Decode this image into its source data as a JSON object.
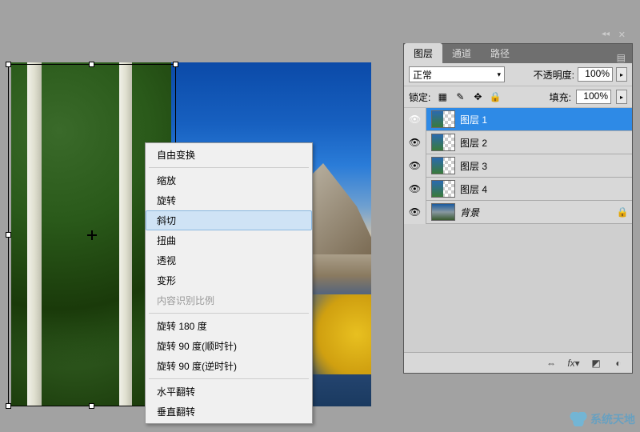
{
  "canvas": {
    "alt": "mountain-lake-landscape"
  },
  "context_menu": {
    "items": [
      {
        "label": "自由变换",
        "sep_after": true
      },
      {
        "label": "缩放"
      },
      {
        "label": "旋转"
      },
      {
        "label": "斜切",
        "selected": true
      },
      {
        "label": "扭曲"
      },
      {
        "label": "透视"
      },
      {
        "label": "变形"
      },
      {
        "label": "内容识别比例",
        "disabled": true,
        "sep_after": true
      },
      {
        "label": "旋转 180 度"
      },
      {
        "label": "旋转 90 度(顺时针)"
      },
      {
        "label": "旋转 90 度(逆时针)",
        "sep_after": true
      },
      {
        "label": "水平翻转"
      },
      {
        "label": "垂直翻转"
      }
    ]
  },
  "panel": {
    "tabs": [
      "图层",
      "通道",
      "路径"
    ],
    "active_tab": 0,
    "blend_mode": "正常",
    "opacity_label": "不透明度:",
    "opacity_value": "100%",
    "lock_label": "锁定:",
    "fill_label": "填充:",
    "fill_value": "100%",
    "layers": [
      {
        "name": "图层 1",
        "visible": true,
        "selected": true,
        "thumb": "partial"
      },
      {
        "name": "图层 2",
        "visible": true,
        "thumb": "partial"
      },
      {
        "name": "图层 3",
        "visible": true,
        "thumb": "partial"
      },
      {
        "name": "图层 4",
        "visible": true,
        "thumb": "partial"
      },
      {
        "name": "背景",
        "visible": true,
        "locked": true,
        "italic": true,
        "thumb": "full"
      }
    ],
    "footer_icons": [
      "link-icon",
      "fx-icon",
      "mask-icon",
      "adjustment-icon"
    ]
  },
  "watermark": {
    "text": "系统天地"
  }
}
